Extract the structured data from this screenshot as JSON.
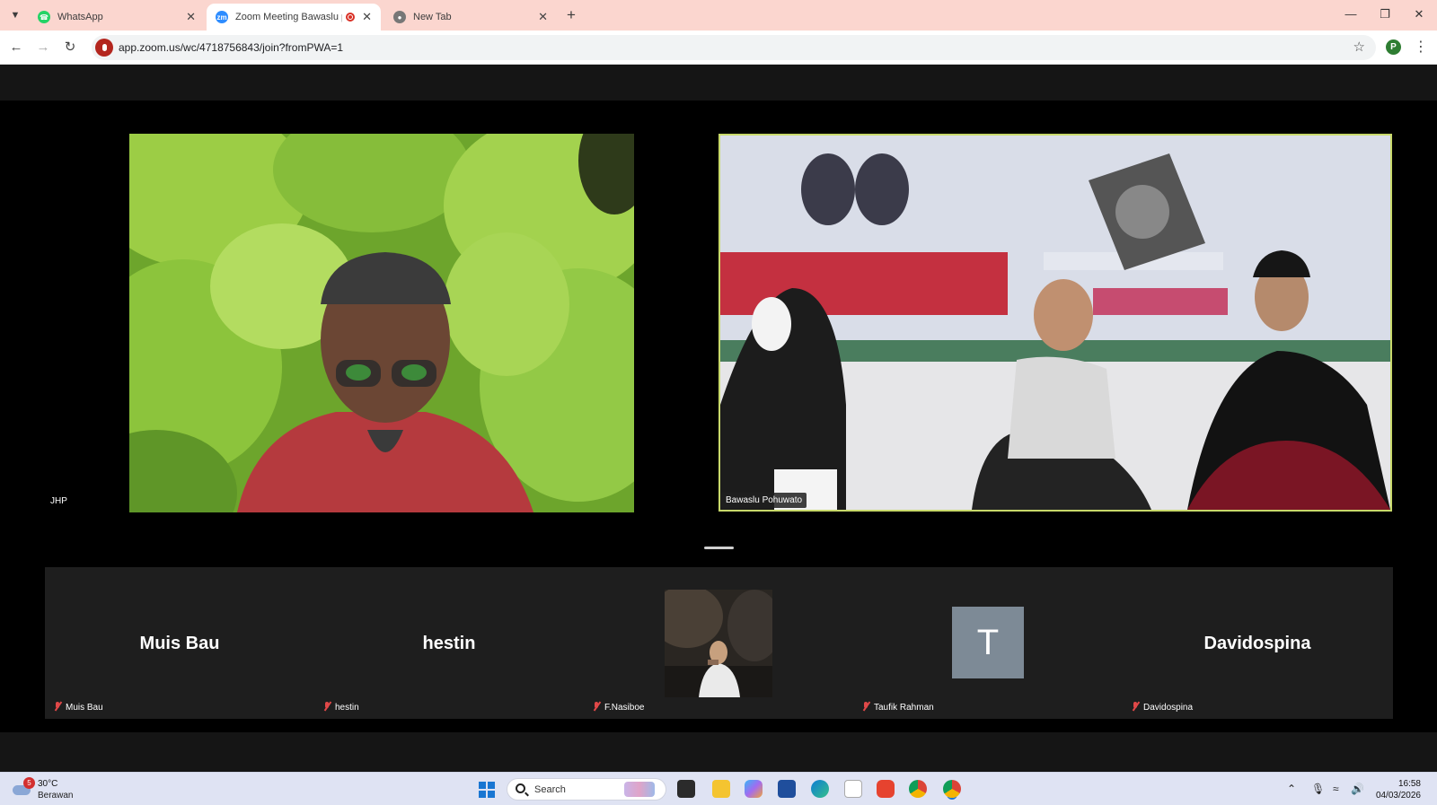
{
  "browser": {
    "tabs": [
      {
        "label": "WhatsApp",
        "icon": "whatsapp-icon",
        "active": false
      },
      {
        "label": "Zoom Meeting Bawaslu po",
        "icon": "zoom-icon",
        "active": true,
        "recording": true
      },
      {
        "label": "New Tab",
        "icon": "chrome-icon",
        "active": false
      }
    ],
    "address": "app.zoom.us/wc/4718756843/join?fromPWA=1",
    "profile_initial": "P"
  },
  "meeting": {
    "speaker_label": "JHP",
    "main_videos": [
      {
        "name": "JHP"
      },
      {
        "name": "Bawaslu Pohuwato",
        "active_speaker": true
      }
    ],
    "gallery": [
      {
        "display_name": "Muis Bau",
        "tag": "Muis Bau",
        "muted": true,
        "kind": "name"
      },
      {
        "display_name": "hestin",
        "tag": "hestin",
        "muted": true,
        "kind": "name"
      },
      {
        "display_name": "",
        "tag": "F.Nasiboe",
        "muted": true,
        "kind": "video"
      },
      {
        "display_name": "T",
        "tag": "Taufik Rahman",
        "muted": true,
        "kind": "avatar"
      },
      {
        "display_name": "Davidospina",
        "tag": "Davidospina",
        "muted": true,
        "kind": "name"
      }
    ]
  },
  "taskbar": {
    "weather": {
      "badge": "5",
      "temp": "30°C",
      "condition": "Berawan"
    },
    "search_placeholder": "Search",
    "time": "16:58",
    "date": "04/03/2026"
  },
  "colors": {
    "tab_bar": "#fbd6cf",
    "active_speaker_border": "#c8d96a",
    "gallery_bg": "#1e1e1e",
    "avatar_bg": "#7d8a96"
  }
}
